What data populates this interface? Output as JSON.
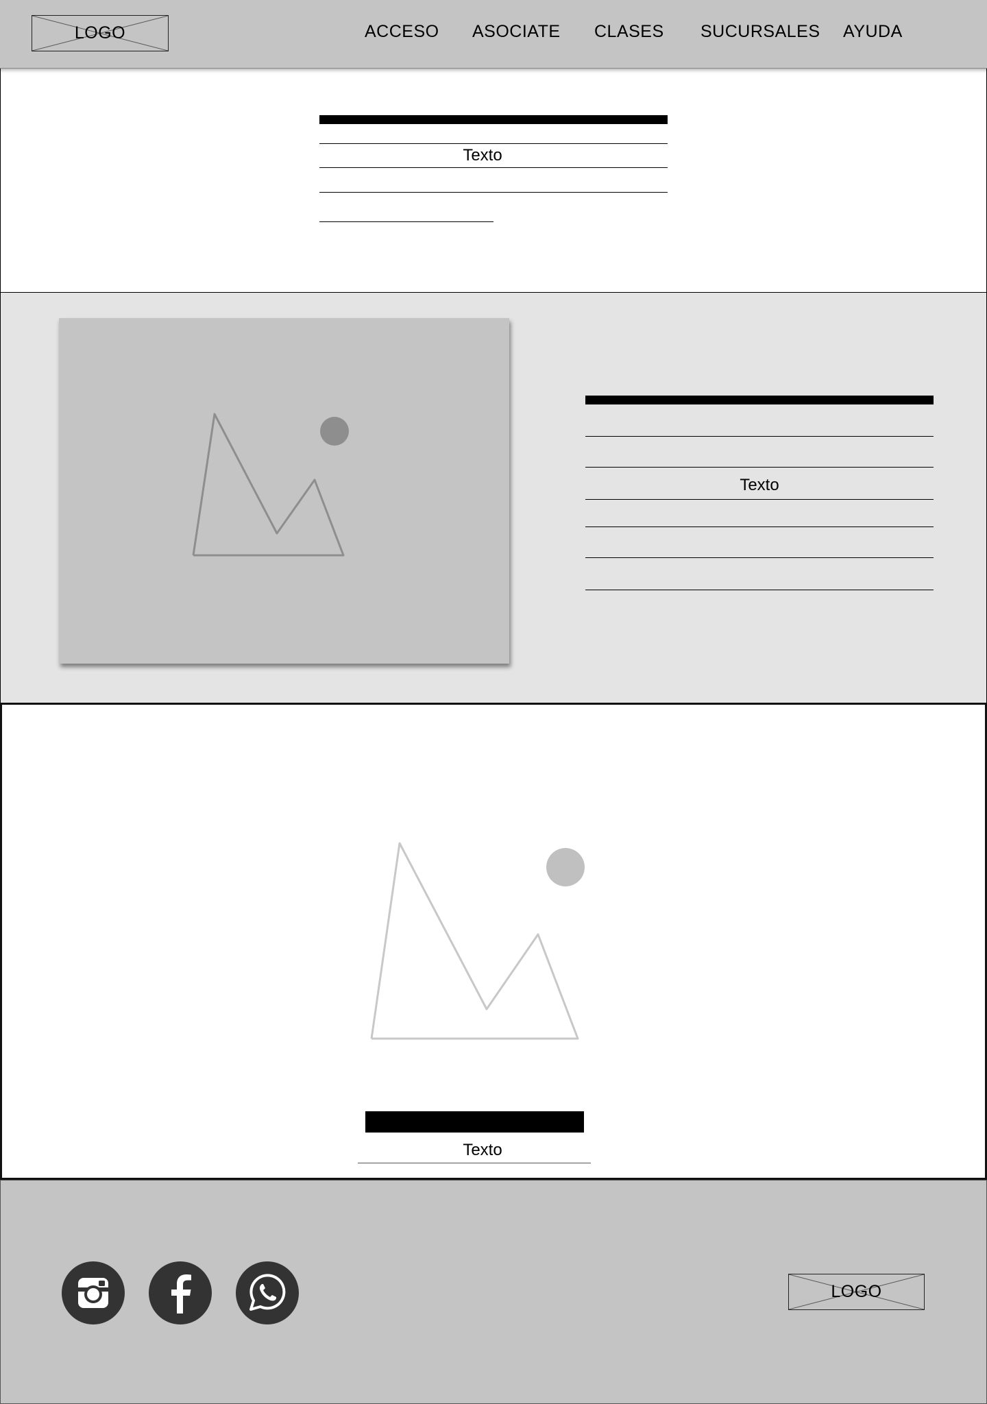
{
  "header": {
    "logo_text": "LOGO",
    "nav": [
      {
        "label": "ACCESO"
      },
      {
        "label": "ASOCIATE"
      },
      {
        "label": "CLASES"
      },
      {
        "label": "SUCURSALES"
      },
      {
        "label": "AYUDA"
      }
    ]
  },
  "section1": {
    "text": "Texto"
  },
  "section2": {
    "text": "Texto",
    "image_icon": "image-placeholder-icon"
  },
  "section3": {
    "text": "Texto",
    "image_icon": "image-placeholder-icon"
  },
  "footer": {
    "logo_text": "LOGO",
    "social": [
      {
        "icon": "instagram-icon"
      },
      {
        "icon": "facebook-icon"
      },
      {
        "icon": "whatsapp-icon"
      }
    ]
  },
  "colors": {
    "header_bg": "#c4c4c4",
    "section2_bg": "#e4e4e4",
    "footer_bg": "#c4c4c4",
    "social_bg": "#333333"
  }
}
